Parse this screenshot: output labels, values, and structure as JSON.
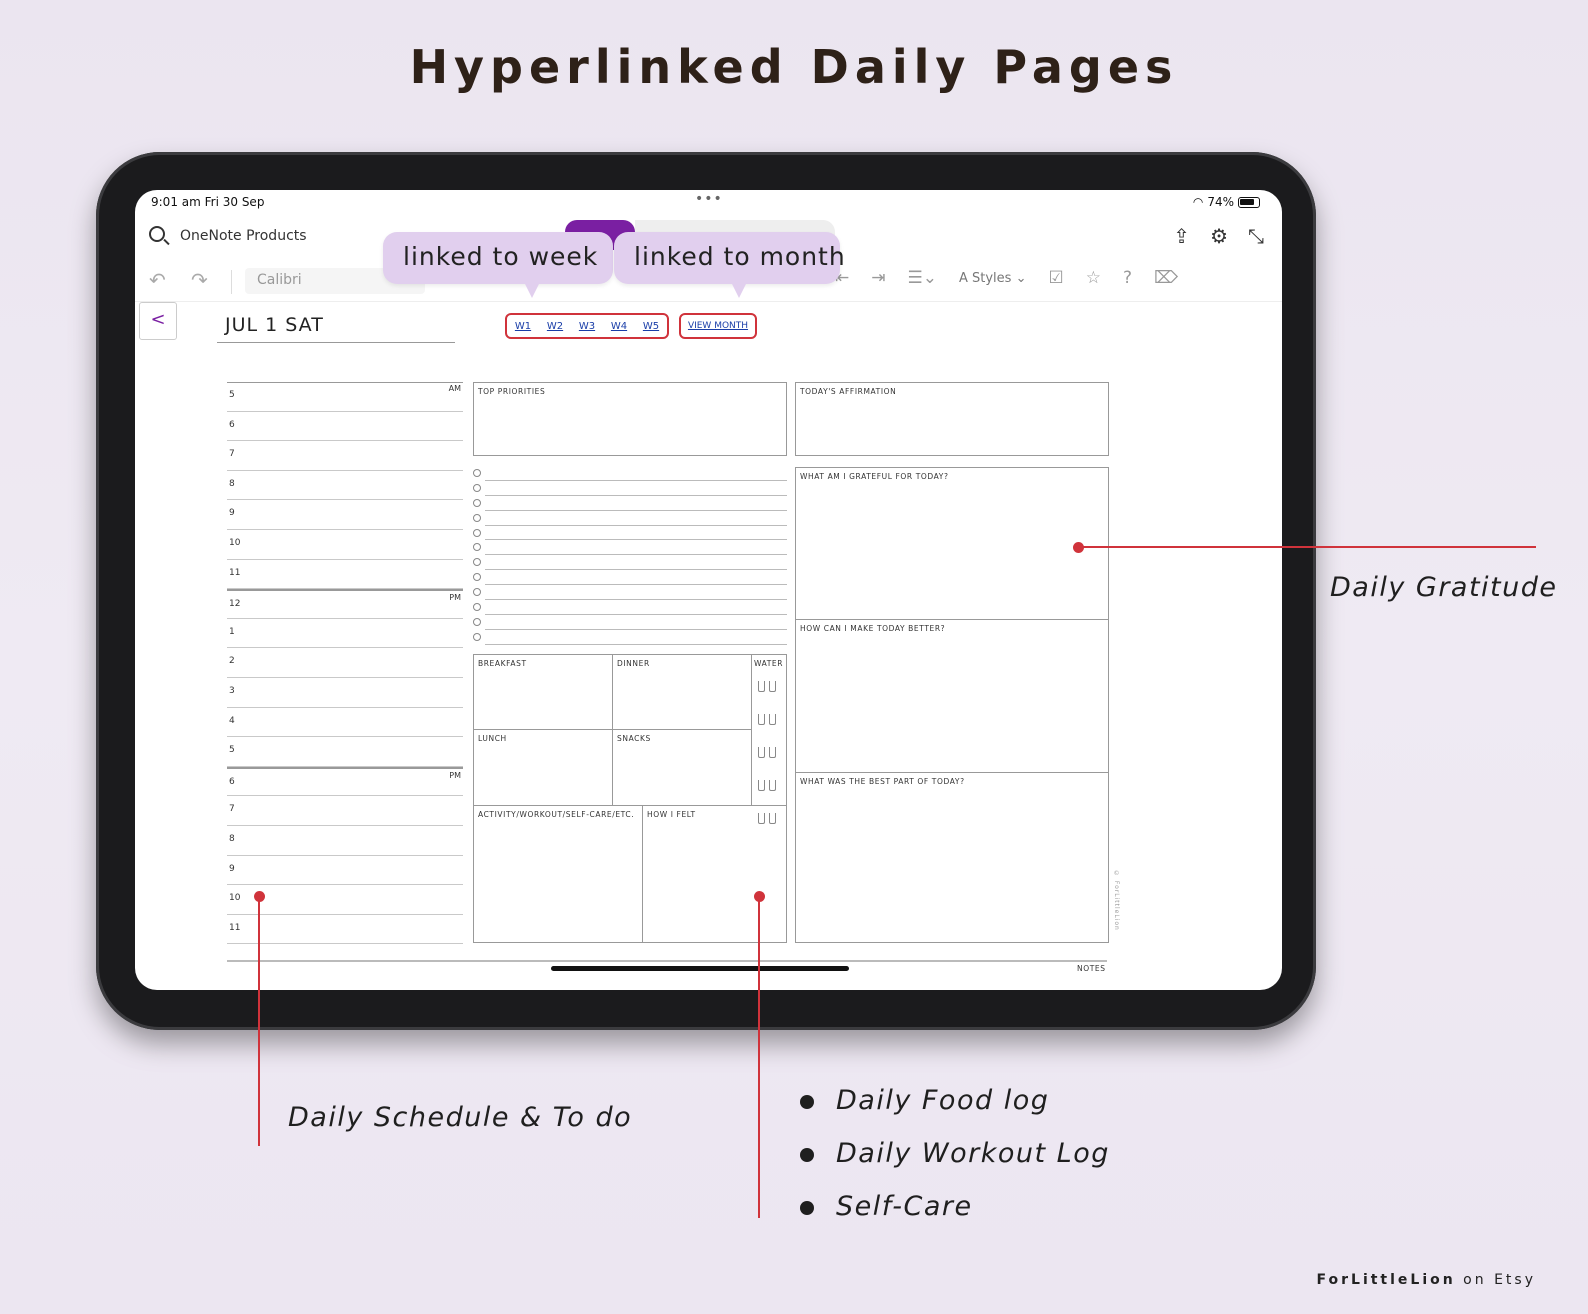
{
  "headline": "Hyperlinked Daily Pages",
  "status": {
    "time": "9:01 am  Fri 30 Sep",
    "battery": "74%"
  },
  "app": {
    "notebook": "OneNote Products",
    "font": "Calibri",
    "styles_label": "Styles",
    "accent": "#7a1fa2"
  },
  "callouts": {
    "week": "linked to week",
    "month": "linked to month"
  },
  "page": {
    "date": "JUL 1  SAT",
    "week_links": [
      "W1",
      "W2",
      "W3",
      "W4",
      "W5"
    ],
    "month_link": "VIEW MONTH",
    "schedule": {
      "am_label": "AM",
      "pm_label": "PM",
      "hours": [
        "5",
        "6",
        "7",
        "8",
        "9",
        "10",
        "11",
        "12",
        "1",
        "2",
        "3",
        "4",
        "5",
        "6",
        "7",
        "8",
        "9",
        "10",
        "11"
      ]
    },
    "sections": {
      "top_priorities": "TOP PRIORITIES",
      "affirmation": "TODAY'S AFFIRMATION",
      "grateful": "WHAT AM I GRATEFUL FOR TODAY?",
      "better": "HOW CAN I MAKE TODAY BETTER?",
      "best_part": "WHAT WAS THE BEST PART OF TODAY?",
      "breakfast": "BREAKFAST",
      "dinner": "DINNER",
      "water": "WATER",
      "lunch": "LUNCH",
      "snacks": "SNACKS",
      "activity": "ACTIVITY/WORKOUT/SELF-CARE/ETC.",
      "how_felt": "HOW I FELT",
      "notes": "NOTES"
    },
    "copyright": "© ForLittleLion"
  },
  "annotations": {
    "gratitude": "Daily Gratitude",
    "schedule": "Daily Schedule & To do",
    "bullets": [
      "Daily Food log",
      "Daily Workout Log",
      "Self-Care"
    ]
  },
  "brand": {
    "name": "ForLittleLion",
    "suffix": " on Etsy"
  },
  "colors": {
    "link_border": "#d0333b",
    "callout_bg": "#e1cfee",
    "link_text": "#1a3ea8"
  }
}
